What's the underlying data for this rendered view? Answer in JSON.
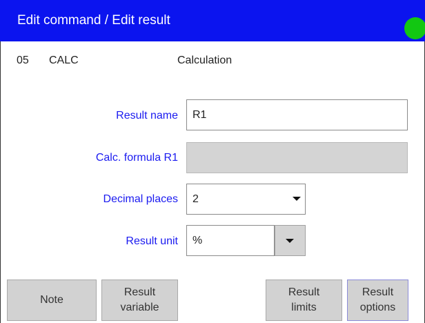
{
  "header": {
    "title": "Edit command / Edit result",
    "status_color": "#12c712"
  },
  "command": {
    "number": "05",
    "code": "CALC",
    "description": "Calculation"
  },
  "form": {
    "result_name": {
      "label": "Result name",
      "value": "R1"
    },
    "calc_formula": {
      "label": "Calc. formula R1",
      "value": ""
    },
    "decimal_places": {
      "label": "Decimal places",
      "value": "2"
    },
    "result_unit": {
      "label": "Result unit",
      "value": "%"
    }
  },
  "buttons": {
    "note": {
      "line1": "Note"
    },
    "result_variable": {
      "line1": "Result",
      "line2": "variable"
    },
    "result_limits": {
      "line1": "Result",
      "line2": "limits"
    },
    "result_options": {
      "line1": "Result",
      "line2": "options"
    }
  },
  "colors": {
    "titlebar": "#0b14ef",
    "label_blue": "#1a1af0",
    "button_gray": "#d2d2d2"
  }
}
